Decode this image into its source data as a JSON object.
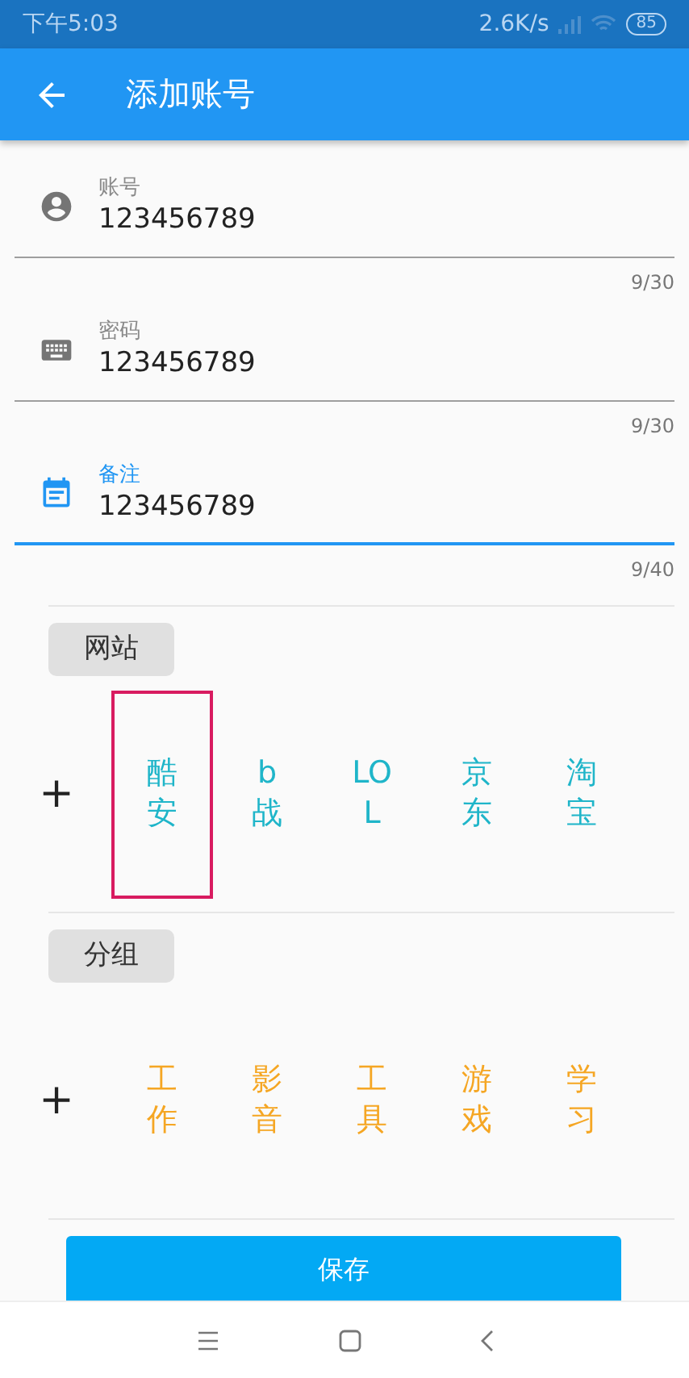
{
  "status_bar": {
    "time": "下午5:03",
    "speed": "2.6K/s",
    "battery": "85"
  },
  "app_bar": {
    "title": "添加账号"
  },
  "fields": [
    {
      "kind": "account",
      "label": "账号",
      "value": "123456789",
      "counter": "9/30",
      "focused": false
    },
    {
      "kind": "password",
      "label": "密码",
      "value": "123456789",
      "counter": "9/30",
      "focused": false
    },
    {
      "kind": "note",
      "label": "备注",
      "value": "123456789",
      "counter": "9/40",
      "focused": true
    }
  ],
  "sections": [
    {
      "kind": "site",
      "chip": "网站",
      "add": "+",
      "items": [
        {
          "label": "酷安",
          "selected": true
        },
        {
          "label": "b战",
          "selected": false
        },
        {
          "label": "LOL",
          "selected": false
        },
        {
          "label": "京东",
          "selected": false
        },
        {
          "label": "淘宝",
          "selected": false
        }
      ]
    },
    {
      "kind": "group",
      "chip": "分组",
      "add": "+",
      "items": [
        {
          "label": "工作",
          "selected": false
        },
        {
          "label": "影音",
          "selected": false
        },
        {
          "label": "工具",
          "selected": false
        },
        {
          "label": "游戏",
          "selected": false
        },
        {
          "label": "学习",
          "selected": false
        }
      ]
    }
  ],
  "save_button": {
    "label": "保存"
  }
}
